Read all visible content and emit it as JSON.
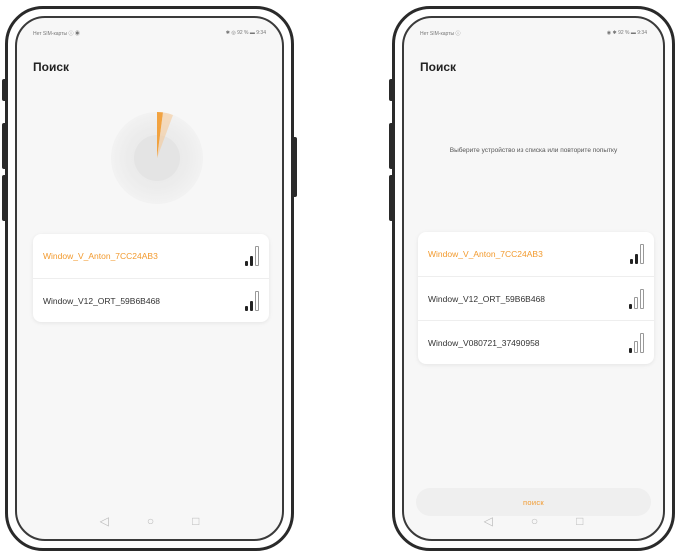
{
  "left": {
    "status_left": "Нет SIM-карты ⓘ ◉",
    "status_right": "✱ ◎ 92 % ▬ 9:34",
    "title": "Поиск",
    "devices": [
      {
        "name": "Window_V_Anton_7CC24AB3",
        "selected": true
      },
      {
        "name": "Window_V12_ORT_59B6B468",
        "selected": false
      }
    ],
    "nav": {
      "back": "◁",
      "home": "○",
      "recent": "□"
    }
  },
  "right": {
    "status_left": "Нет SIM-карты ⓘ",
    "status_right": "◉ ✱ 92 % ▬ 9:34",
    "title": "Поиск",
    "message": "Выберите устройство из списка или повторите попытку",
    "devices": [
      {
        "name": "Window_V_Anton_7CC24AB3",
        "selected": true
      },
      {
        "name": "Window_V12_ORT_59B6B468",
        "selected": false
      },
      {
        "name": "Window_V080721_37490958",
        "selected": false
      }
    ],
    "search_button": "поиск",
    "nav": {
      "back": "◁",
      "home": "○",
      "recent": "□"
    }
  },
  "colors": {
    "accent": "#f29a2e",
    "text": "#333333",
    "background": "#f7f7f7"
  },
  "icons": [
    "wifi-signal-icon",
    "back-icon",
    "home-icon",
    "recent-apps-icon"
  ]
}
